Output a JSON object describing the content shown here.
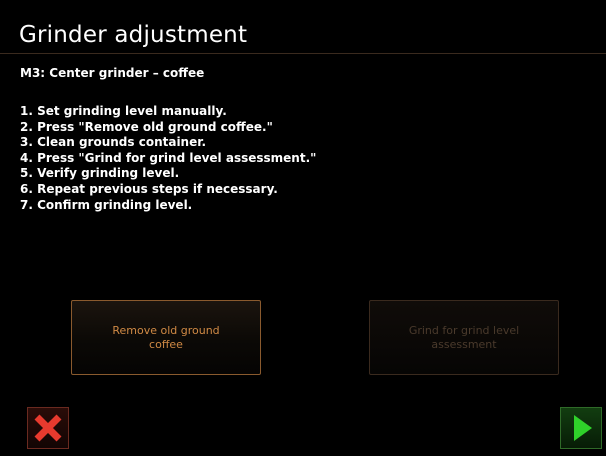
{
  "header": {
    "title": "Grinder adjustment",
    "subtitle": "M3: Center grinder – coffee"
  },
  "instructions": {
    "steps": [
      "1. Set grinding level manually.",
      "2. Press \"Remove old ground coffee.\"",
      "3. Clean grounds container.",
      "4. Press \"Grind for grind level assessment.\"",
      "5. Verify grinding level.",
      "6. Repeat previous steps if necessary.",
      "7. Confirm grinding level."
    ]
  },
  "actions": {
    "remove_label": "Remove old ground coffee",
    "grind_label": "Grind for grind level assessment",
    "grind_enabled": false
  },
  "navigation": {
    "cancel_icon": "close-icon",
    "next_icon": "play-arrow-icon"
  },
  "colors": {
    "background": "#000000",
    "accent_orange": "#d08a45",
    "cancel_red": "#e83a2e",
    "next_green": "#2fd12a",
    "disabled_text": "#4a3a2c"
  }
}
